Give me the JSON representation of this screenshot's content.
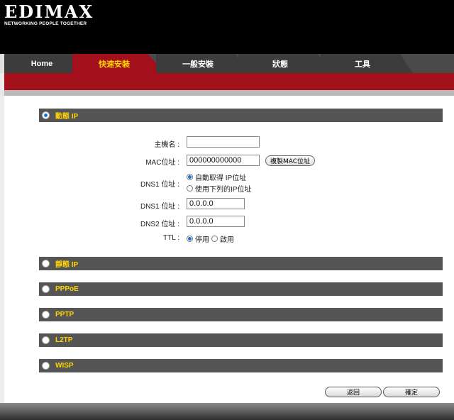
{
  "brand": {
    "name": "EDIMAX",
    "tagline": "NETWORKING PEOPLE TOGETHER"
  },
  "tabs": [
    {
      "label": "Home",
      "active": false
    },
    {
      "label": "快速安裝",
      "active": true
    },
    {
      "label": "一般安裝",
      "active": false
    },
    {
      "label": "狀態",
      "active": false
    },
    {
      "label": "工具",
      "active": false
    }
  ],
  "sections": {
    "dynamic_ip": {
      "label": "動態 IP",
      "selected": true
    },
    "static_ip": {
      "label": "靜態 IP",
      "selected": false
    },
    "pppoe": {
      "label": "PPPoE",
      "selected": false
    },
    "pptp": {
      "label": "PPTP",
      "selected": false
    },
    "l2tp": {
      "label": "L2TP",
      "selected": false
    },
    "wisp": {
      "label": "WISP",
      "selected": false
    }
  },
  "form": {
    "hostname_label": "主機名 :",
    "hostname_value": "",
    "mac_label": "MAC位址 :",
    "mac_value": "000000000000",
    "clone_mac_button": "複製MAC位址",
    "dns1_mode_label": "DNS1 位址 :",
    "dns_auto_option": "自動取得 IP位址",
    "dns_manual_option": "使用下列的IP位址",
    "dns1_label": "DNS1 位址 :",
    "dns1_value": "0.0.0.0",
    "dns2_label": "DNS2 位址 :",
    "dns2_value": "0.0.0.0",
    "ttl_label": "TTL :",
    "ttl_disable": "停用",
    "ttl_enable": "啟用"
  },
  "buttons": {
    "back": "返回",
    "ok": "確定"
  },
  "colors": {
    "accent_red": "#a3101c",
    "tab_active_text": "#ffd400",
    "section_text": "#ffd400",
    "radio_selected": "#1a6fd6"
  }
}
